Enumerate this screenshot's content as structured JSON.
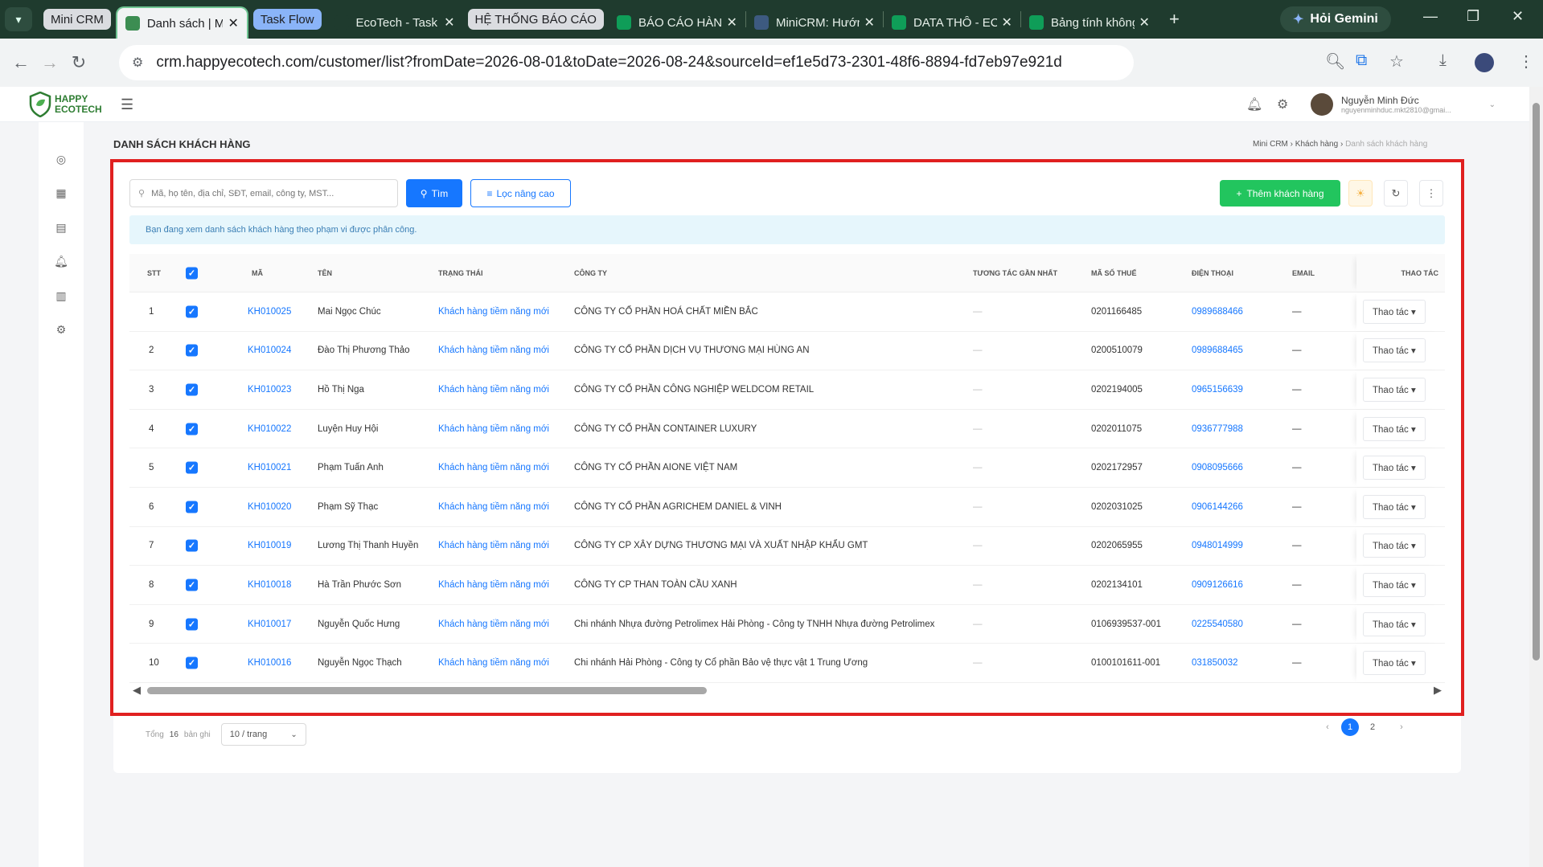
{
  "browser": {
    "tab_search_icon": "chevron-down-icon",
    "tab_groups": [
      {
        "label": "Mini CRM",
        "bg": "#dadce0",
        "fg": "#202124"
      },
      {
        "label": "Task Flow",
        "bg": "#8ab4f8",
        "fg": "#202124"
      },
      {
        "label": "HỆ THỐNG BÁO CÁO",
        "bg": "#dadce0",
        "fg": "#202124"
      }
    ],
    "tabs": [
      {
        "title": "Danh sách | Mini CRM",
        "favicon": "happy-ecotech-icon",
        "color": "#3c8d52",
        "active": true
      },
      {
        "title": "EcoTech - Task Flow",
        "favicon": "letter-a-icon",
        "color": "#1f3b2e",
        "active": false
      },
      {
        "title": "BÁO CÁO HÀNG NGÀY",
        "favicon": "sheets-icon",
        "color": "#0f9d58",
        "active": false
      },
      {
        "title": "MiniCRM: Hướng dẫn",
        "favicon": "letter-h-icon",
        "color": "#3d5a80",
        "active": false
      },
      {
        "title": "DATA THÔ - ECOTECH",
        "favicon": "sheets-icon",
        "color": "#0f9d58",
        "active": false
      },
      {
        "title": "Bảng tính không tên",
        "favicon": "sheets-icon",
        "color": "#0f9d58",
        "active": false
      }
    ],
    "new_tab": "+",
    "gemini_label": "Hỏi Gemini",
    "url": "crm.happyecotech.com/customer/list?fromDate=2026-08-01&toDate=2026-08-24&sourceId=ef1e5d73-2301-48f6-8894-fd7eb97e921d"
  },
  "app": {
    "logo_line1": "HAPPY",
    "logo_line2": "ECOTECH",
    "user_name": "Nguyễn Minh Đức",
    "user_email": "nguyenminhduc.mkt2810@gmai...",
    "page_title": "DANH SÁCH KHÁCH HÀNG",
    "breadcrumb": [
      "Mini CRM",
      "Khách hàng",
      "Danh sách khách hàng"
    ],
    "search_placeholder": "Mã, họ tên, địa chỉ, SĐT, email, công ty, MST...",
    "find_label": "Tìm",
    "filter_label": "Lọc nâng cao",
    "add_label": "Thêm khách hàng",
    "notice": "Bạn đang xem danh sách khách hàng theo phạm vi được phân công.",
    "columns": {
      "stt": "STT",
      "code": "MÃ",
      "name": "TÊN",
      "status": "TRẠNG THÁI",
      "company": "CÔNG TY",
      "last": "TƯƠNG TÁC GẦN NHẤT",
      "tax": "MÃ SỐ THUẾ",
      "phone": "ĐIỆN THOẠI",
      "email": "EMAIL",
      "action": "THAO TÁC"
    },
    "action_label": "Thao tác ▾",
    "rows": [
      {
        "stt": "1",
        "code": "KH010025",
        "name": "Mai Ngọc Chúc",
        "status": "Khách hàng tiềm năng mới",
        "company": "CÔNG TY CỔ PHẦN HOÁ CHẤT MIỀN BẮC",
        "last": "—",
        "tax": "0201166485",
        "phone": "0989688466",
        "email": "—"
      },
      {
        "stt": "2",
        "code": "KH010024",
        "name": "Đào Thị Phương Thảo",
        "status": "Khách hàng tiềm năng mới",
        "company": "CÔNG TY CỔ PHẦN DỊCH VỤ THƯƠNG MẠI HÙNG AN",
        "last": "—",
        "tax": "0200510079",
        "phone": "0989688465",
        "email": "—"
      },
      {
        "stt": "3",
        "code": "KH010023",
        "name": "Hồ Thị Nga",
        "status": "Khách hàng tiềm năng mới",
        "company": "CÔNG TY CỔ PHẦN CÔNG NGHIỆP WELDCOM RETAIL",
        "last": "—",
        "tax": "0202194005",
        "phone": "0965156639",
        "email": "—"
      },
      {
        "stt": "4",
        "code": "KH010022",
        "name": "Luyện Huy Hội",
        "status": "Khách hàng tiềm năng mới",
        "company": "CÔNG TY CỔ PHẦN CONTAINER LUXURY",
        "last": "—",
        "tax": "0202011075",
        "phone": "0936777988",
        "email": "—"
      },
      {
        "stt": "5",
        "code": "KH010021",
        "name": "Phạm Tuấn Anh",
        "status": "Khách hàng tiềm năng mới",
        "company": "CÔNG TY CỔ PHẦN AIONE VIỆT NAM",
        "last": "—",
        "tax": "0202172957",
        "phone": "0908095666",
        "email": "—"
      },
      {
        "stt": "6",
        "code": "KH010020",
        "name": "Phạm Sỹ Thạc",
        "status": "Khách hàng tiềm năng mới",
        "company": "CÔNG TY CỔ PHẦN AGRICHEM DANIEL & VINH",
        "last": "—",
        "tax": "0202031025",
        "phone": "0906144266",
        "email": "—"
      },
      {
        "stt": "7",
        "code": "KH010019",
        "name": "Lương Thị Thanh Huyền",
        "status": "Khách hàng tiềm năng mới",
        "company": "CÔNG TY CP XÂY DỰNG THƯƠNG MẠI VÀ XUẤT NHẬP KHẨU GMT",
        "last": "—",
        "tax": "0202065955",
        "phone": "0948014999",
        "email": "—"
      },
      {
        "stt": "8",
        "code": "KH010018",
        "name": "Hà Trần Phước Sơn",
        "status": "Khách hàng tiềm năng mới",
        "company": "CÔNG TY CP THAN TOÀN CẦU XANH",
        "last": "—",
        "tax": "0202134101",
        "phone": "0909126616",
        "email": "—"
      },
      {
        "stt": "9",
        "code": "KH010017",
        "name": "Nguyễn Quốc Hưng",
        "status": "Khách hàng tiềm năng mới",
        "company": "Chi nhánh Nhựa đường Petrolimex Hải Phòng - Công ty TNHH Nhựa đường Petrolimex",
        "last": "—",
        "tax": "0106939537-001",
        "phone": "0225540580",
        "email": "—"
      },
      {
        "stt": "10",
        "code": "KH010016",
        "name": "Nguyễn Ngọc Thạch",
        "status": "Khách hàng tiềm năng mới",
        "company": "Chi nhánh Hải Phòng - Công ty Cổ phần Bảo vệ thực vật 1 Trung Ương",
        "last": "—",
        "tax": "0100101611-001",
        "phone": "031850032",
        "email": "—"
      }
    ],
    "total_prefix": "Tổng",
    "total_count": "16",
    "total_suffix": "bản ghi",
    "page_size": "10 / trang",
    "pages": [
      "1",
      "2"
    ],
    "current_page": "1"
  },
  "colors": {
    "primary": "#1677ff",
    "add_button": "#22c55e",
    "highlight_border": "#e02020"
  }
}
